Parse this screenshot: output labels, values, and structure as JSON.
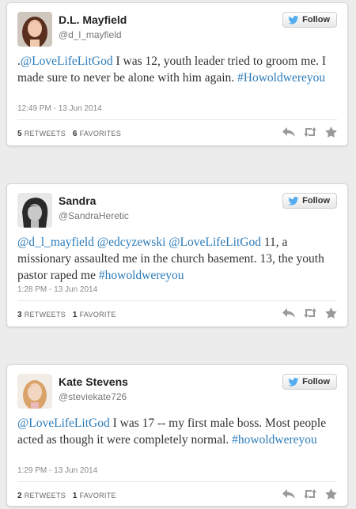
{
  "colors": {
    "link": "#2b7bb9",
    "twitter_bird": "#55acee",
    "action_icon": "#999999"
  },
  "tweets": [
    {
      "name": "D.L. Mayfield",
      "handle": "@d_l_mayfield",
      "follow_label": "Follow",
      "text_segments": [
        {
          "text": ".",
          "link": false
        },
        {
          "text": "@LoveLifeLitGod",
          "link": true
        },
        {
          "text": " I was 12, youth leader tried to groom me. I made sure to never be alone with him again. ",
          "link": false
        },
        {
          "text": "#Howoldwereyou",
          "link": true
        }
      ],
      "timestamp": "12:49 PM - 13 Jun 2014",
      "retweets_count": "5",
      "retweets_label": "Retweets",
      "favorites_count": "6",
      "favorites_label": "Favorites"
    },
    {
      "name": "Sandra",
      "handle": "@SandraHeretic",
      "follow_label": "Follow",
      "text_segments": [
        {
          "text": "@d_l_mayfield",
          "link": true
        },
        {
          "text": " ",
          "link": false
        },
        {
          "text": "@edcyzewski",
          "link": true
        },
        {
          "text": " ",
          "link": false
        },
        {
          "text": "@LoveLifeLitGod",
          "link": true
        },
        {
          "text": " 11, a missionary assaulted me in the church basement. 13, the youth pastor raped me ",
          "link": false
        },
        {
          "text": "#howoldwereyou",
          "link": true
        }
      ],
      "timestamp": "1:28 PM - 13 Jun 2014",
      "retweets_count": "3",
      "retweets_label": "Retweets",
      "favorites_count": "1",
      "favorites_label": "Favorite"
    },
    {
      "name": "Kate Stevens",
      "handle": "@steviekate726",
      "follow_label": "Follow",
      "text_segments": [
        {
          "text": "@LoveLifeLitGod",
          "link": true
        },
        {
          "text": " I was 17 -- my first male boss. Most people acted as though it were completely normal. ",
          "link": false
        },
        {
          "text": "#howoldwereyou",
          "link": true
        }
      ],
      "timestamp": "1:29 PM - 13 Jun 2014",
      "retweets_count": "2",
      "retweets_label": "Retweets",
      "favorites_count": "1",
      "favorites_label": "Favorite"
    }
  ],
  "icons": {
    "follow": "twitter-bird-icon",
    "reply": "reply-icon",
    "retweet": "retweet-icon",
    "favorite": "star-icon"
  }
}
